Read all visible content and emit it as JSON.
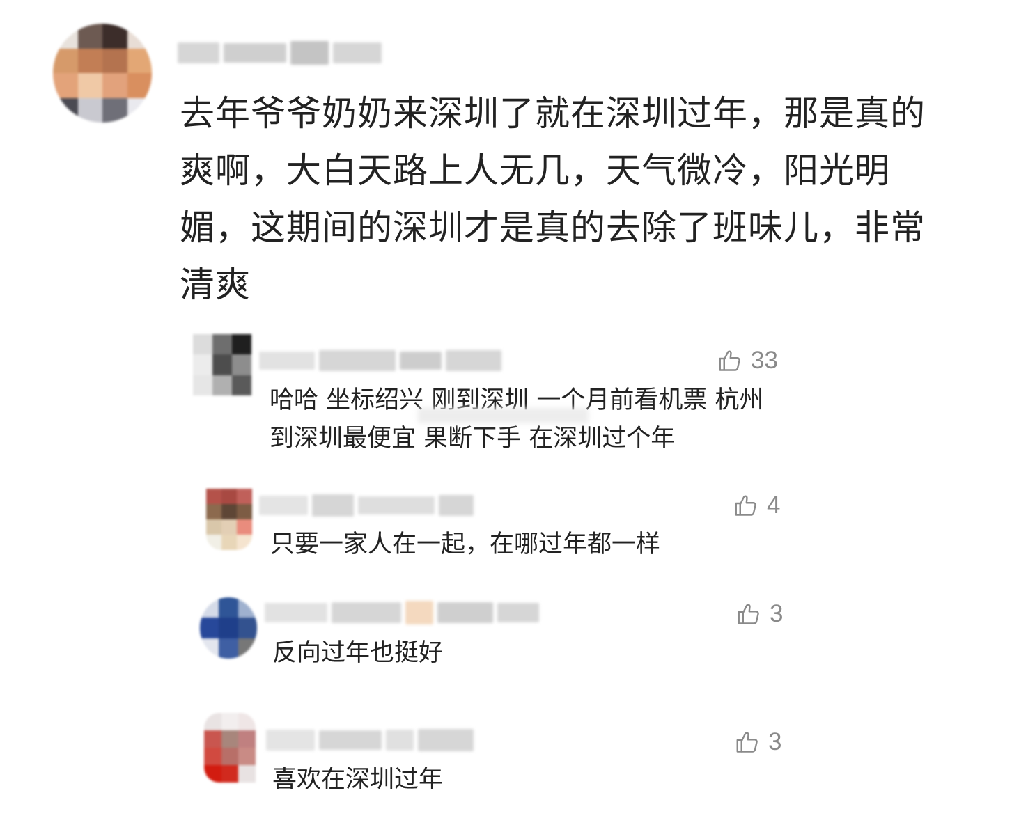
{
  "main_comment": {
    "text": "去年爷爷奶奶来深圳了就在深圳过年，那是真的爽啊，大白天路上人无几，天气微冷，阳光明媚，这期间的深圳才是真的去除了班味儿，非常清爽"
  },
  "replies": [
    {
      "text": "哈哈 坐标绍兴 刚到深圳 一个月前看机票 杭州到深圳最便宜 果断下手 在深圳过个年",
      "likes": "33"
    },
    {
      "text": "只要一家人在一起，在哪过年都一样",
      "likes": "4"
    },
    {
      "text": "反向过年也挺好",
      "likes": "3"
    },
    {
      "text": "喜欢在深圳过年",
      "likes": "3"
    }
  ],
  "colors": {
    "text": "#222222",
    "like": "#8a8a8a",
    "blurred_placeholder": "#d6d6d6"
  },
  "icons": {
    "like": "thumbs-up-icon"
  }
}
